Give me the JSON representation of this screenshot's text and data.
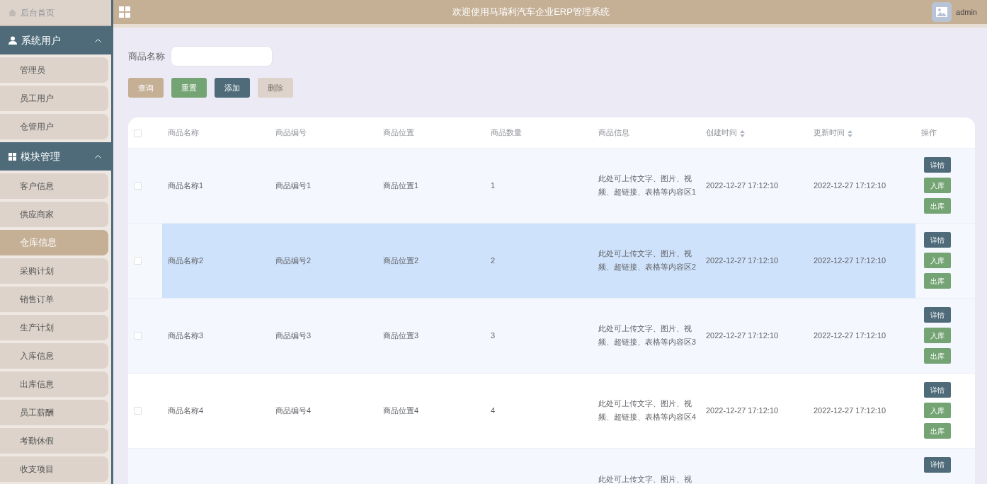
{
  "sidebar": {
    "home": "后台首页",
    "groups": [
      {
        "title": "系统用户",
        "expanded": true,
        "items": [
          {
            "label": "管理员",
            "selected": false
          },
          {
            "label": "员工用户",
            "selected": false
          },
          {
            "label": "仓管用户",
            "selected": false
          }
        ]
      },
      {
        "title": "模块管理",
        "expanded": true,
        "items": [
          {
            "label": "客户信息",
            "selected": false
          },
          {
            "label": "供应商家",
            "selected": false
          },
          {
            "label": "仓库信息",
            "selected": true
          },
          {
            "label": "采购计划",
            "selected": false
          },
          {
            "label": "销售订单",
            "selected": false
          },
          {
            "label": "生产计划",
            "selected": false
          },
          {
            "label": "入库信息",
            "selected": false
          },
          {
            "label": "出库信息",
            "selected": false
          },
          {
            "label": "员工薪酬",
            "selected": false
          },
          {
            "label": "考勤休假",
            "selected": false
          },
          {
            "label": "收支项目",
            "selected": false
          }
        ]
      }
    ]
  },
  "header": {
    "title": "欢迎使用马瑞利汽车企业ERP管理系统",
    "user": "admin"
  },
  "search": {
    "label": "商品名称"
  },
  "toolbar": [
    {
      "label": "查询",
      "kind": "query"
    },
    {
      "label": "重置",
      "kind": "reset"
    },
    {
      "label": "添加",
      "kind": "add"
    },
    {
      "label": "删除",
      "kind": "delete"
    }
  ],
  "table": {
    "select_all": {
      "checked": false
    },
    "columns": [
      {
        "label": "商品名称",
        "sortable": false
      },
      {
        "label": "商品编号",
        "sortable": false
      },
      {
        "label": "商品位置",
        "sortable": false
      },
      {
        "label": "商品数量",
        "sortable": false
      },
      {
        "label": "商品信息",
        "sortable": false
      },
      {
        "label": "创建时间",
        "sortable": true
      },
      {
        "label": "更新时间",
        "sortable": true
      },
      {
        "label": "操作",
        "sortable": false
      }
    ],
    "rows": [
      {
        "checked": false,
        "hovered": false,
        "cells": [
          "商品名称1",
          "商品编号1",
          "商品位置1",
          "1",
          "此处可上传文字、图片、视频、超链接、表格等内容区1",
          "2022-12-27 17:12:10",
          "2022-12-27 17:12:10"
        ],
        "actions": [
          {
            "label": "详情",
            "kind": "detail"
          },
          {
            "label": "入库",
            "kind": "in"
          },
          {
            "label": "出库",
            "kind": "out"
          }
        ]
      },
      {
        "checked": false,
        "hovered": true,
        "cells": [
          "商品名称2",
          "商品编号2",
          "商品位置2",
          "2",
          "此处可上传文字、图片、视频、超链接、表格等内容区2",
          "2022-12-27 17:12:10",
          "2022-12-27 17:12:10"
        ],
        "actions": [
          {
            "label": "详情",
            "kind": "detail"
          },
          {
            "label": "入库",
            "kind": "in"
          },
          {
            "label": "出库",
            "kind": "out"
          }
        ]
      },
      {
        "checked": false,
        "hovered": false,
        "cells": [
          "商品名称3",
          "商品编号3",
          "商品位置3",
          "3",
          "此处可上传文字、图片、视频、超链接、表格等内容区3",
          "2022-12-27 17:12:10",
          "2022-12-27 17:12:10"
        ],
        "actions": [
          {
            "label": "详情",
            "kind": "detail"
          },
          {
            "label": "入库",
            "kind": "in"
          },
          {
            "label": "出库",
            "kind": "out"
          }
        ]
      },
      {
        "checked": false,
        "hovered": false,
        "cells": [
          "商品名称4",
          "商品编号4",
          "商品位置4",
          "4",
          "此处可上传文字、图片、视频、超链接、表格等内容区4",
          "2022-12-27 17:12:10",
          "2022-12-27 17:12:10"
        ],
        "actions": [
          {
            "label": "详情",
            "kind": "detail"
          },
          {
            "label": "入库",
            "kind": "in"
          },
          {
            "label": "出库",
            "kind": "out"
          }
        ]
      },
      {
        "hovered": false,
        "info": "此处可上传文字、图片、视",
        "actions": [
          {
            "label": "详情",
            "kind": "detail"
          }
        ]
      }
    ]
  }
}
